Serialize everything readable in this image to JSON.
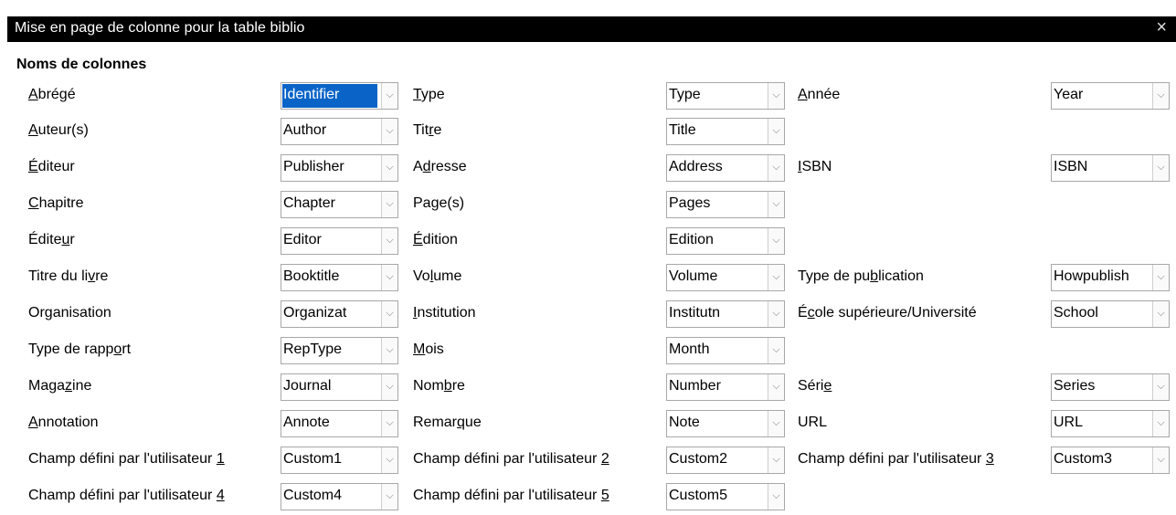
{
  "window": {
    "title": "Mise en page de colonne pour la table biblio",
    "close_glyph": "×"
  },
  "group_label": "Noms de colonnes",
  "dropdown_glyph": "⌵",
  "rows": [
    [
      {
        "label_pre": "",
        "label_u": "A",
        "label_post": "brégé",
        "value": "Identifier",
        "selected": true
      },
      {
        "label_pre": "",
        "label_u": "T",
        "label_post": "ype",
        "value": "Type"
      },
      {
        "label_pre": "",
        "label_u": "A",
        "label_post": "nnée",
        "value": "Year"
      }
    ],
    [
      {
        "label_pre": "",
        "label_u": "A",
        "label_post": "uteur(s)",
        "value": "Author"
      },
      {
        "label_pre": "Tit",
        "label_u": "r",
        "label_post": "e",
        "value": "Title"
      },
      null
    ],
    [
      {
        "label_pre": "",
        "label_u": "É",
        "label_post": "diteur",
        "value": "Publisher"
      },
      {
        "label_pre": "A",
        "label_u": "d",
        "label_post": "resse",
        "value": "Address"
      },
      {
        "label_pre": "",
        "label_u": "I",
        "label_post": "SBN",
        "value": "ISBN"
      }
    ],
    [
      {
        "label_pre": "",
        "label_u": "C",
        "label_post": "hapitre",
        "value": "Chapter"
      },
      {
        "label_pre": "Pa",
        "label_u": "g",
        "label_post": "e(s)",
        "value": "Pages"
      },
      null
    ],
    [
      {
        "label_pre": "Édite",
        "label_u": "u",
        "label_post": "r",
        "value": "Editor"
      },
      {
        "label_pre": "",
        "label_u": "É",
        "label_post": "dition",
        "value": "Edition"
      },
      null
    ],
    [
      {
        "label_pre": "Titre du li",
        "label_u": "v",
        "label_post": "re",
        "value": "Booktitle"
      },
      {
        "label_pre": "Vo",
        "label_u": "l",
        "label_post": "ume",
        "value": "Volume"
      },
      {
        "label_pre": "Type de pu",
        "label_u": "b",
        "label_post": "lication",
        "value": "Howpublish"
      }
    ],
    [
      {
        "label_pre": "Or",
        "label_u": "g",
        "label_post": "anisation",
        "value": "Organizat"
      },
      {
        "label_pre": "",
        "label_u": "I",
        "label_post": "nstitution",
        "value": "Institutn"
      },
      {
        "label_pre": "É",
        "label_u": "c",
        "label_post": "ole supérieure/Université",
        "value": "School"
      }
    ],
    [
      {
        "label_pre": "Type de rapp",
        "label_u": "o",
        "label_post": "rt",
        "value": "RepType"
      },
      {
        "label_pre": "",
        "label_u": "M",
        "label_post": "ois",
        "value": "Month"
      },
      null
    ],
    [
      {
        "label_pre": "Maga",
        "label_u": "z",
        "label_post": "ine",
        "value": "Journal"
      },
      {
        "label_pre": "Nom",
        "label_u": "b",
        "label_post": "re",
        "value": "Number"
      },
      {
        "label_pre": "Séri",
        "label_u": "e",
        "label_post": "",
        "value": "Series"
      }
    ],
    [
      {
        "label_pre": "",
        "label_u": "A",
        "label_post": "nnotation",
        "value": "Annote"
      },
      {
        "label_pre": "Remar",
        "label_u": "q",
        "label_post": "ue",
        "value": "Note"
      },
      {
        "label_pre": "",
        "label_u": "",
        "label_post": "URL",
        "value": "URL"
      }
    ],
    [
      {
        "label_pre": "Champ défini par l'utilisateur ",
        "label_u": "1",
        "label_post": "",
        "value": "Custom1"
      },
      {
        "label_pre": "Champ défini par l'utilisateur ",
        "label_u": "2",
        "label_post": "",
        "value": "Custom2"
      },
      {
        "label_pre": "Champ défini par l'utilisateur ",
        "label_u": "3",
        "label_post": "",
        "value": "Custom3"
      }
    ],
    [
      {
        "label_pre": "Champ défini par l'utilisateur ",
        "label_u": "4",
        "label_post": "",
        "value": "Custom4"
      },
      {
        "label_pre": "Champ défini par l'utilisateur ",
        "label_u": "5",
        "label_post": "",
        "value": "Custom5"
      },
      null
    ]
  ]
}
